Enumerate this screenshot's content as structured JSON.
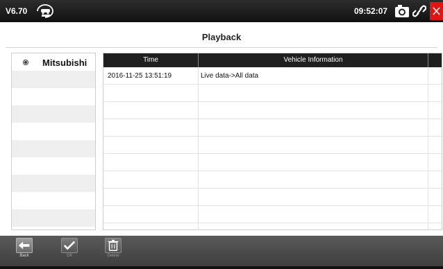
{
  "status_bar": {
    "version": "V6.70",
    "time": "09:52:07",
    "vin_icon": "vin-car-icon",
    "camera_icon": "camera-icon",
    "link_icon": "link-icon",
    "close_icon": "close-icon",
    "close_color": "#e01414"
  },
  "page": {
    "title": "Playback"
  },
  "brands": {
    "selected": "Mitsubishi",
    "row_count": 10
  },
  "table": {
    "headers": {
      "time": "Time",
      "vehicle": "Vehicle Information"
    },
    "rows": [
      {
        "time": "2016-11-25 13:51:19",
        "vehicle": "Live data->All data"
      }
    ],
    "empty_rows": 9
  },
  "toolbar": {
    "back_label": "Back",
    "ok_label": "OK",
    "delete_label": "Delete"
  }
}
